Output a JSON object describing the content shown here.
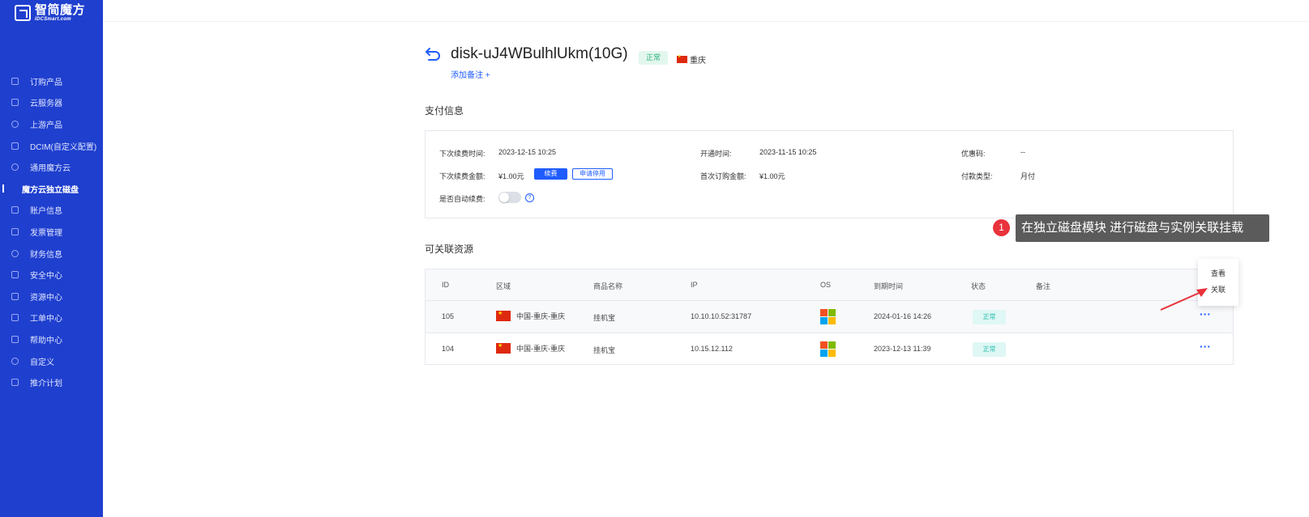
{
  "brand": {
    "name_cn": "智简魔方",
    "name_en": "IDCSmart.com"
  },
  "sidebar": {
    "items": [
      {
        "label": "订购产品",
        "icon": "cart-icon",
        "active": false
      },
      {
        "label": "云服务器",
        "icon": "database-icon",
        "active": false
      },
      {
        "label": "上游产品",
        "icon": "info-icon",
        "active": false
      },
      {
        "label": "DCIM(自定义配置)",
        "icon": "document-icon",
        "active": false
      },
      {
        "label": "通用魔方云",
        "icon": "cloud-icon",
        "active": false
      },
      {
        "label": "魔方云独立磁盘",
        "icon": "disk-icon",
        "active": true
      },
      {
        "label": "账户信息",
        "icon": "user-card-icon",
        "active": false
      },
      {
        "label": "发票管理",
        "icon": "invoice-icon",
        "active": false
      },
      {
        "label": "财务信息",
        "icon": "finance-icon",
        "active": false
      },
      {
        "label": "安全中心",
        "icon": "lock-icon",
        "active": false
      },
      {
        "label": "资源中心",
        "icon": "tag-icon",
        "active": false
      },
      {
        "label": "工单中心",
        "icon": "ticket-icon",
        "active": false
      },
      {
        "label": "帮助中心",
        "icon": "help-book-icon",
        "active": false
      },
      {
        "label": "自定义",
        "icon": "clock-icon",
        "active": false
      },
      {
        "label": "推介计划",
        "icon": "share-icon",
        "active": false
      }
    ]
  },
  "header": {
    "title": "disk-uJ4WBulhlUkm(10G)",
    "status": "正常",
    "region": "重庆",
    "add_remark": "添加备注 +"
  },
  "payment": {
    "section_title": "支付信息",
    "next_renew_time_label": "下次续费时间:",
    "next_renew_time": "2023-12-15 10:25",
    "open_time_label": "开通时间:",
    "open_time": "2023-11-15 10:25",
    "coupon_label": "优惠码:",
    "coupon": "--",
    "next_renew_amount_label": "下次续费金额:",
    "next_renew_amount": "¥1.00元",
    "renew_button": "续费",
    "apply_stop_button": "申请停用",
    "first_order_amount_label": "首次订购金额:",
    "first_order_amount": "¥1.00元",
    "pay_type_label": "付款类型:",
    "pay_type": "月付",
    "auto_renew_label": "是否自动续费:",
    "auto_renew_enabled": false
  },
  "resources": {
    "section_title": "可关联资源",
    "columns": [
      "ID",
      "区域",
      "商品名称",
      "IP",
      "OS",
      "到期时间",
      "状态",
      "备注"
    ],
    "rows": [
      {
        "id": "105",
        "region": "中国-重庆-重庆",
        "product": "挂机宝",
        "ip": "10.10.10.52:31787",
        "os": "windows",
        "expire": "2024-01-16 14:26",
        "status": "正常",
        "remark": ""
      },
      {
        "id": "104",
        "region": "中国-重庆-重庆",
        "product": "挂机宝",
        "ip": "10.15.12.112",
        "os": "windows",
        "expire": "2023-12-13 11:39",
        "status": "正常",
        "remark": ""
      }
    ],
    "more_glyph": "···"
  },
  "popover": {
    "view": "查看",
    "link": "关联"
  },
  "annotation": {
    "badge": "1",
    "text": "在独立磁盘模块 进行磁盘与实例关联挂载"
  },
  "colors": {
    "sidebar_bg": "#1f3fce",
    "accent": "#1f5cff",
    "tooltip_bg": "#5b5b5b",
    "badge_red": "#e8323c"
  }
}
